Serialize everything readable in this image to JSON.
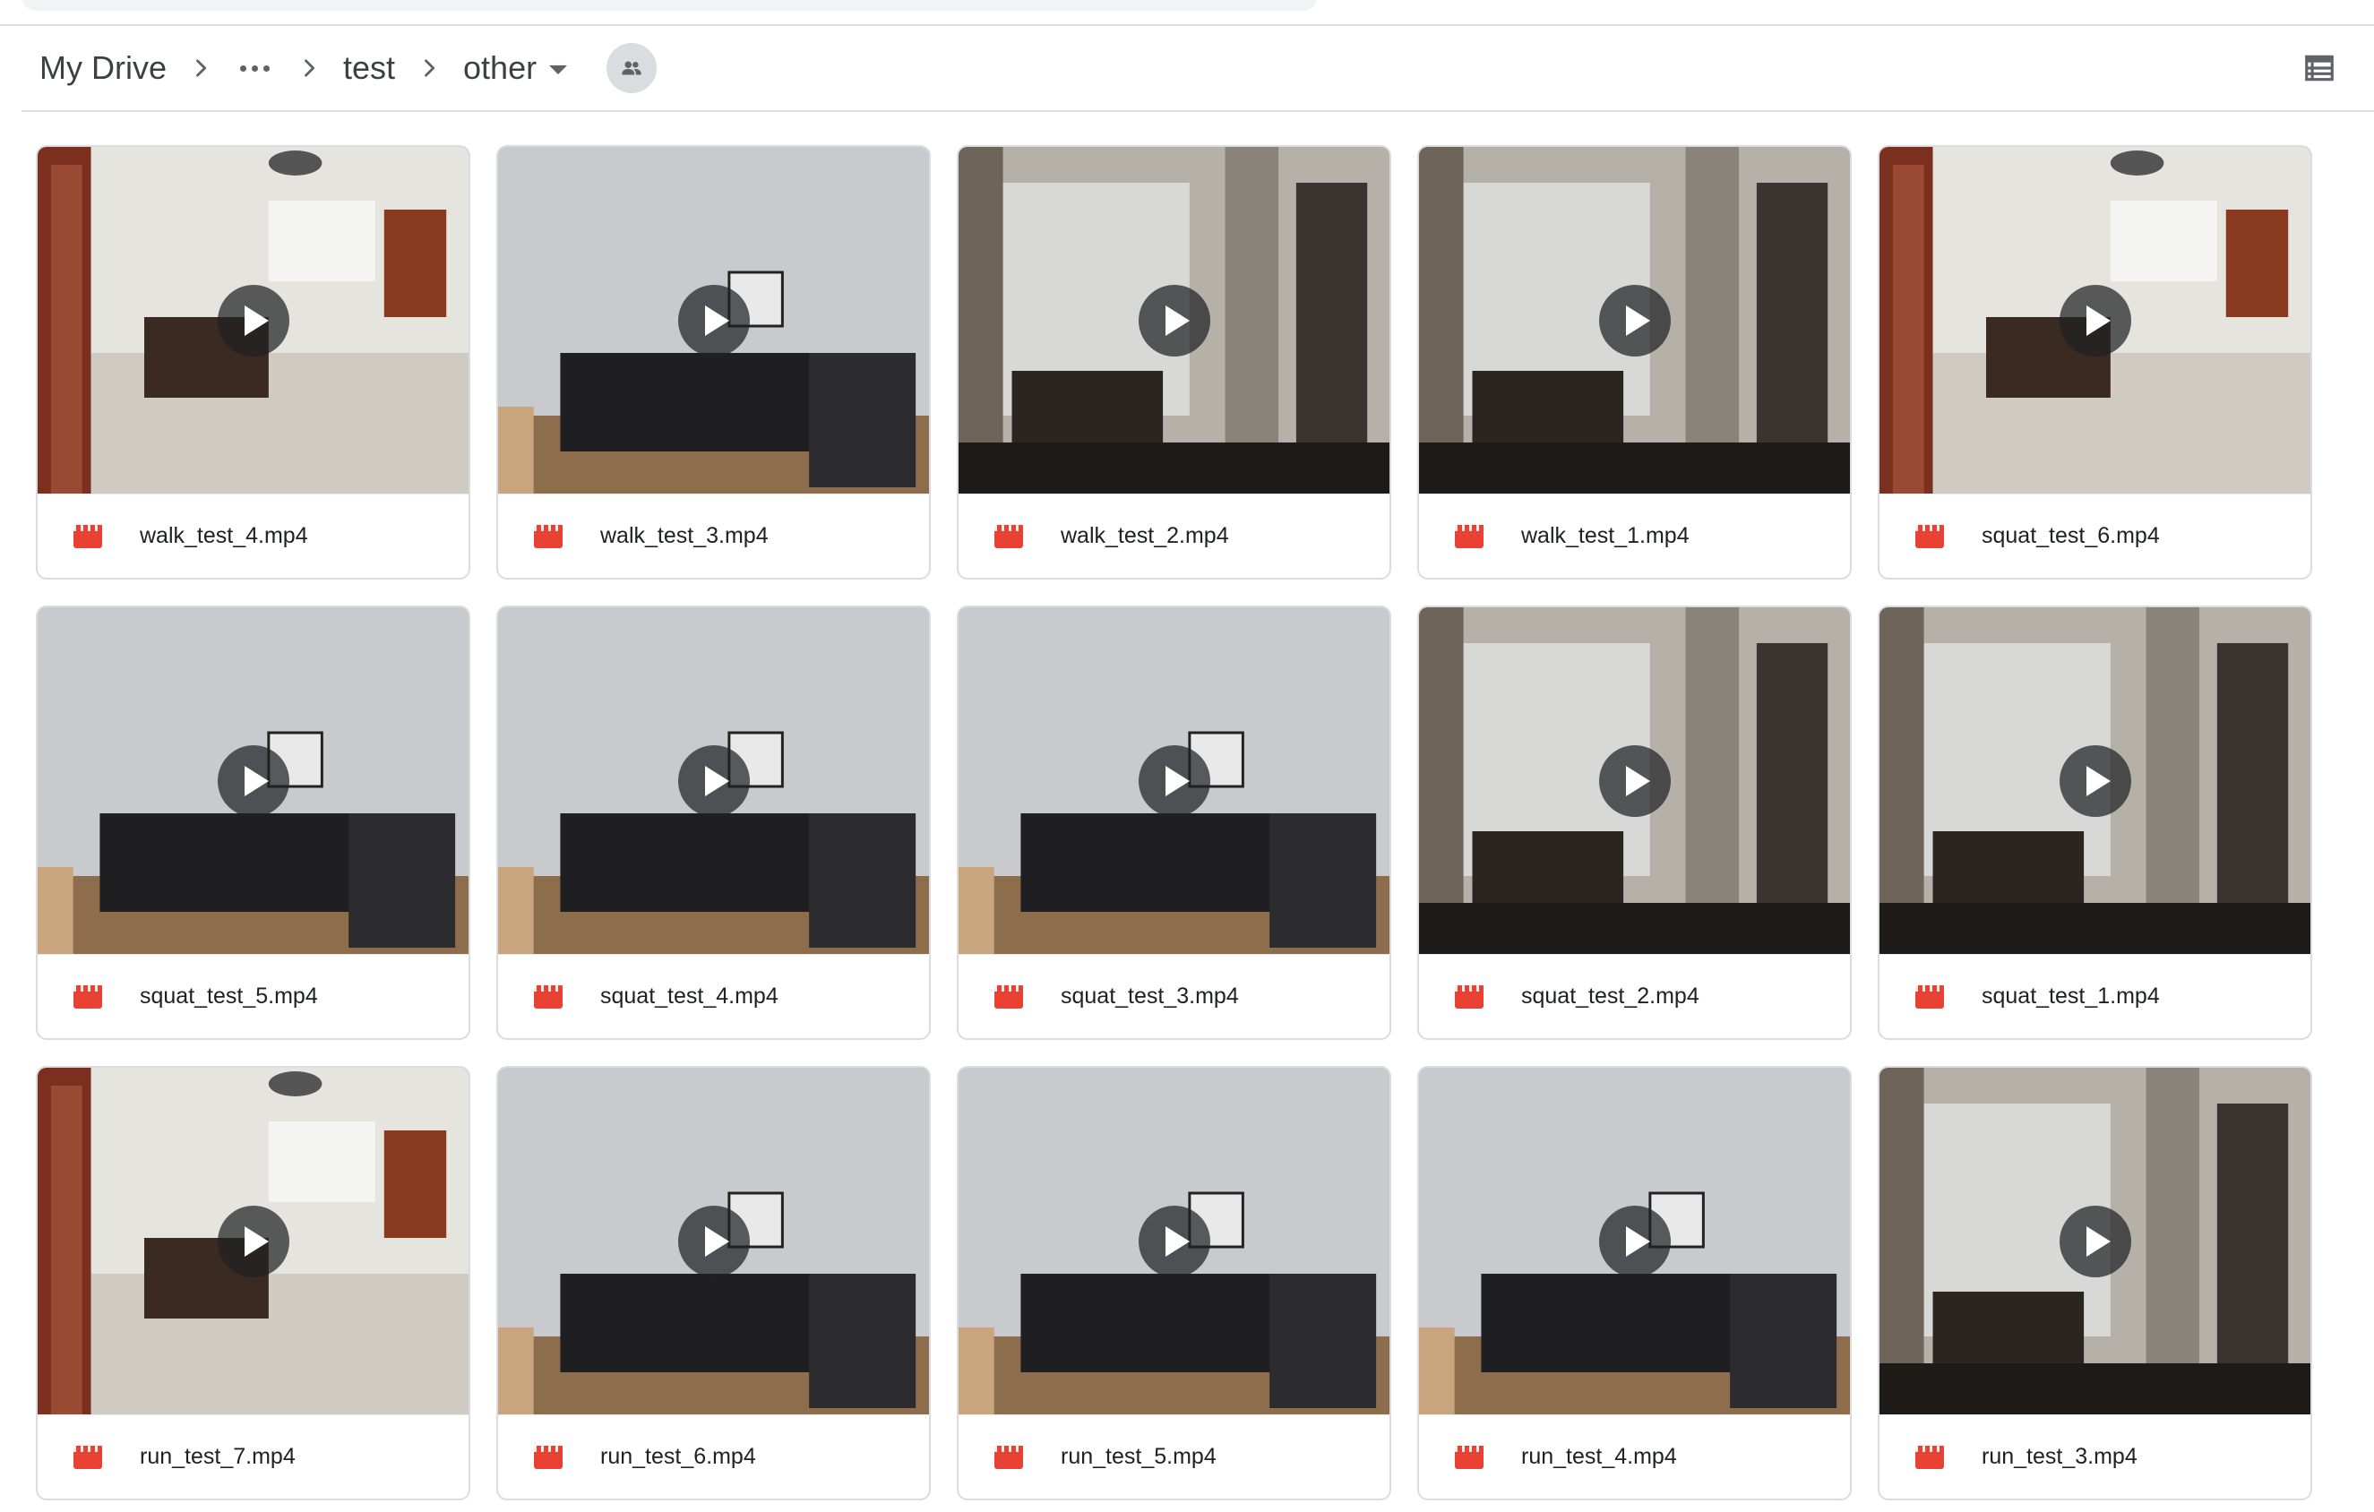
{
  "breadcrumb": {
    "items": [
      "My Drive",
      "test",
      "other"
    ],
    "overflow_icon": "more-horiz-icon",
    "separator_icon": "chevron-right-icon",
    "current_dropdown_icon": "arrow-drop-down-icon",
    "shared_icon": "people-icon"
  },
  "toolbar": {
    "view_toggle_icon": "list-view-icon"
  },
  "colors": {
    "divider": "#e0e0e0",
    "card_border": "#dadce0",
    "video_icon": "#e94235",
    "text": "#202124"
  },
  "files": [
    {
      "name": "walk_test_4.mp4",
      "type": "video",
      "scene": "room"
    },
    {
      "name": "walk_test_3.mp4",
      "type": "video",
      "scene": "desk"
    },
    {
      "name": "walk_test_2.mp4",
      "type": "video",
      "scene": "hall"
    },
    {
      "name": "walk_test_1.mp4",
      "type": "video",
      "scene": "hall"
    },
    {
      "name": "squat_test_6.mp4",
      "type": "video",
      "scene": "room"
    },
    {
      "name": "squat_test_5.mp4",
      "type": "video",
      "scene": "desk"
    },
    {
      "name": "squat_test_4.mp4",
      "type": "video",
      "scene": "desk"
    },
    {
      "name": "squat_test_3.mp4",
      "type": "video",
      "scene": "desk"
    },
    {
      "name": "squat_test_2.mp4",
      "type": "video",
      "scene": "hall"
    },
    {
      "name": "squat_test_1.mp4",
      "type": "video",
      "scene": "hall"
    },
    {
      "name": "run_test_7.mp4",
      "type": "video",
      "scene": "room"
    },
    {
      "name": "run_test_6.mp4",
      "type": "video",
      "scene": "desk"
    },
    {
      "name": "run_test_5.mp4",
      "type": "video",
      "scene": "desk"
    },
    {
      "name": "run_test_4.mp4",
      "type": "video",
      "scene": "desk"
    },
    {
      "name": "run_test_3.mp4",
      "type": "video",
      "scene": "hall"
    }
  ]
}
